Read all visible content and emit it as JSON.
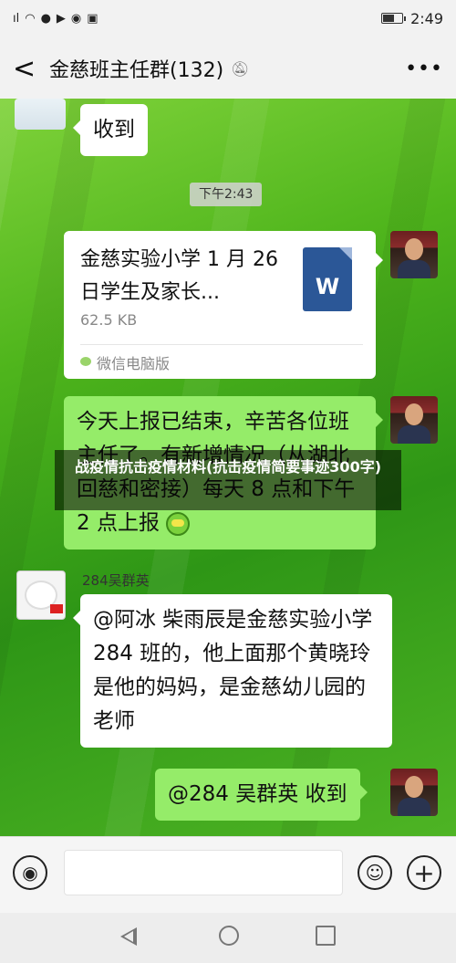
{
  "status_bar": {
    "signal_text": "5G·ıl",
    "time": "2:49",
    "battery_level": 0.6
  },
  "header": {
    "back_icon": "chevron-left-icon",
    "title": "金慈班主任群(132)",
    "mute_icon": "bell-off-icon",
    "more_icon": "more-horizontal-icon"
  },
  "messages": {
    "m1_text": "收到",
    "timestamp": "下午2:43",
    "file": {
      "name": "金慈实验小学 1 月 26 日学生及家长...",
      "size": "62.5 KB",
      "source": "微信电脑版",
      "type_label": "W"
    },
    "m3_text": "今天上报已结束，辛苦各位班主任了。有新增情况（从湖北回慈和密接）每天 8 点和下午 2 点上报",
    "m4_sender": "284吴群英",
    "m4_text": "@阿冰  柴雨辰是金慈实验小学 284 班的，他上面那个黄晓玲是他的妈妈，是金慈幼儿园的老师",
    "m5_text": "@284 吴群英  收到"
  },
  "overlay": {
    "caption": "战疫情抗击疫情材料(抗击疫情简要事迹300字)"
  },
  "input_bar": {
    "voice_icon": "voice-icon",
    "emoji_icon": "emoji-icon",
    "add_icon": "plus-icon"
  },
  "system_nav": {
    "back_icon": "triangle-back-icon",
    "home_icon": "circle-home-icon",
    "recent_icon": "square-recent-icon"
  }
}
